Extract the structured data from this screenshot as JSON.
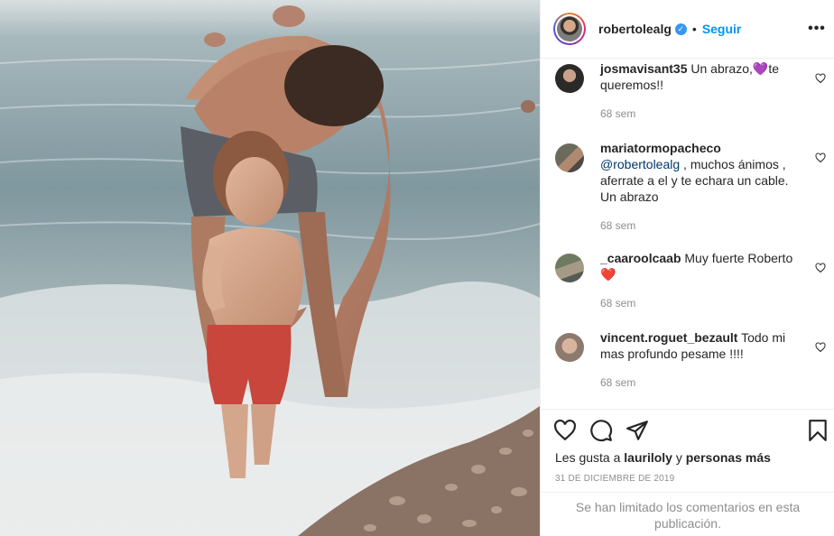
{
  "post": {
    "username": "robertolealg",
    "verified_glyph": "✓",
    "separator": "•",
    "follow_label": "Seguir",
    "more_label": "•••",
    "photo_icon": "beach-photo"
  },
  "comments": [
    {
      "username": "josmavisant35",
      "parts": [
        " Un abrazo,",
        "💜",
        "te queremos!!"
      ],
      "time": "68 sem"
    },
    {
      "username": "mariatormopacheco",
      "mention": "@robertolealg",
      "text": " , muchos ánimos , aferrate a el y te echara un cable. Un abrazo",
      "time": "68 sem"
    },
    {
      "username": "_caaroolcaab",
      "text": " Muy fuerte Roberto",
      "emoji": "❤️",
      "time": "68 sem"
    },
    {
      "username": "vincent.roguet_bezault",
      "text": " Todo mi mas profundo pesame !!!!",
      "time": "68 sem"
    }
  ],
  "actions": {
    "likes_prefix": "Les gusta a ",
    "likes_user": "lauriloly",
    "likes_middle": " y ",
    "likes_suffix": "personas más",
    "date": "31 DE DICIEMBRE DE 2019",
    "limited_notice": "Se han limitado los comentarios en esta publicación."
  },
  "colors": {
    "accent": "#0095f6",
    "verified": "#3897f0",
    "muted": "#8e8e8e",
    "text": "#262626",
    "mention": "#00376b"
  }
}
